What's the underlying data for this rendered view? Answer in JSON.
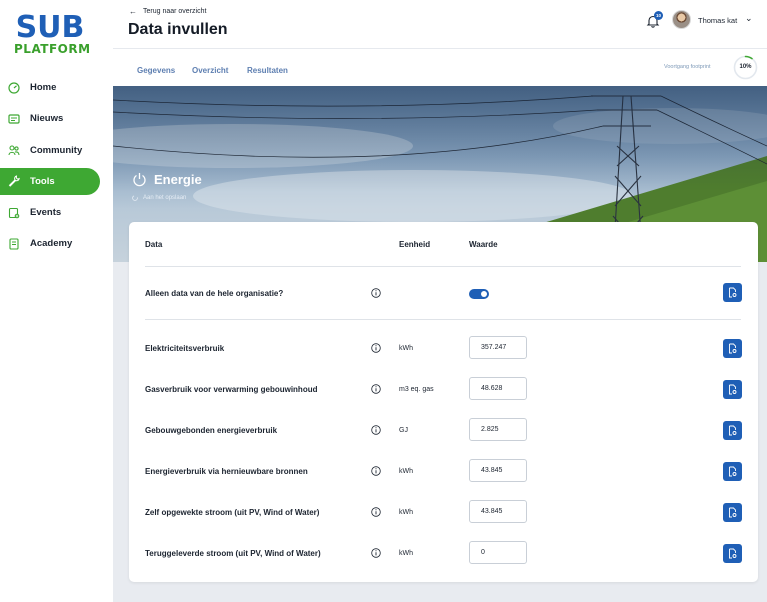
{
  "brand": {
    "logo_top": "SUB",
    "logo_bottom": "PLATFORM",
    "blue": "#1f5fb6",
    "green": "#3ea833"
  },
  "sidebar": {
    "items": [
      {
        "label": "Home",
        "icon": "gauge-icon",
        "active": false
      },
      {
        "label": "Nieuws",
        "icon": "newspaper-icon",
        "active": false
      },
      {
        "label": "Community",
        "icon": "people-icon",
        "active": false
      },
      {
        "label": "Tools",
        "icon": "wrench-icon",
        "active": true
      },
      {
        "label": "Events",
        "icon": "calendar-plus-icon",
        "active": false
      },
      {
        "label": "Academy",
        "icon": "book-icon",
        "active": false
      }
    ]
  },
  "header": {
    "back_label": "Terug naar overzicht",
    "title": "Data invullen",
    "notification_count": "10",
    "user_name": "Thomas kat"
  },
  "subnav": {
    "tabs": [
      "Gegevens",
      "Overzicht",
      "Resultaten"
    ],
    "progress_label": "Voortgang footprint",
    "progress_percent": 10,
    "progress_text": "10%"
  },
  "section": {
    "title": "Energie",
    "save_status": "Aan het opslaan"
  },
  "table": {
    "headers": {
      "data": "Data",
      "unit": "Eenheid",
      "value": "Waarde"
    },
    "org_toggle": {
      "label": "Alleen data van de hele organisatie?",
      "on": true
    },
    "rows": [
      {
        "label": "Elektriciteitsverbruik",
        "unit": "kWh",
        "value": "357.247"
      },
      {
        "label": "Gasverbruik voor verwarming gebouwinhoud",
        "unit": "m3 eq. gas",
        "value": "48.628"
      },
      {
        "label": "Gebouwgebonden energieverbruik",
        "unit": "GJ",
        "value": "2.825"
      },
      {
        "label": "Energieverbruik via hernieuwbare bronnen",
        "unit": "kWh",
        "value": "43.845"
      },
      {
        "label": "Zelf opgewekte stroom (uit PV, Wind of Water)",
        "unit": "kWh",
        "value": "43.845"
      },
      {
        "label": "Teruggeleverde stroom (uit PV, Wind of Water)",
        "unit": "kWh",
        "value": "0"
      }
    ]
  }
}
